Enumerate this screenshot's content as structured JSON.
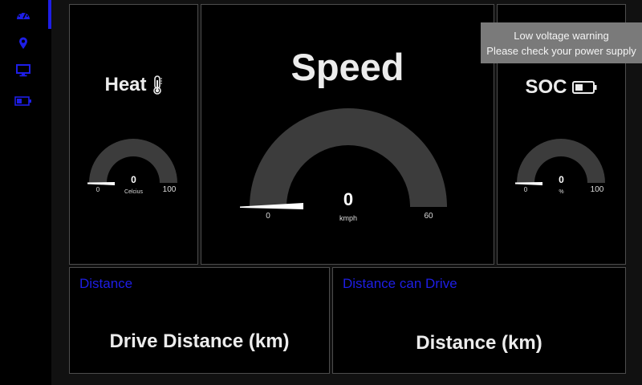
{
  "sidebar": {
    "items": [
      {
        "icon": "dashboard-icon",
        "active": true
      },
      {
        "icon": "map-pin-icon",
        "active": false
      },
      {
        "icon": "monitor-icon",
        "active": false
      },
      {
        "icon": "battery-icon",
        "active": false
      }
    ],
    "accent_color": "#1e1ee6"
  },
  "gauges": {
    "heat": {
      "title": "Heat",
      "icon": "thermometer-icon",
      "value": "0",
      "unit": "Celcius",
      "min": "0",
      "max": "100",
      "fraction": 0
    },
    "speed": {
      "title": "Speed",
      "value": "0",
      "unit": "kmph",
      "min": "0",
      "max": "60",
      "fraction": 0
    },
    "soc": {
      "title": "SOC",
      "icon": "battery-icon",
      "value": "0",
      "unit": "%",
      "min": "0",
      "max": "100",
      "fraction": 0
    }
  },
  "distance": {
    "label": "Distance",
    "value_text": "Drive Distance (km)"
  },
  "distance_can_drive": {
    "label": "Distance can Drive",
    "value_text": "Distance (km)"
  },
  "notification": {
    "line1": "Low voltage warning",
    "line2": "Please check your power supply"
  }
}
